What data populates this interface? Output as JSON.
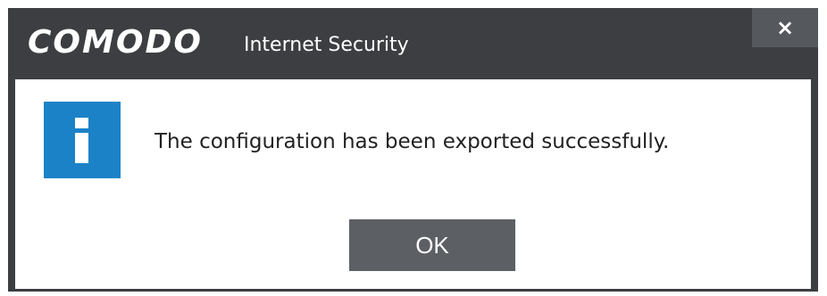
{
  "window": {
    "brand": "COMODO",
    "product": "Internet Security",
    "close_label": "×"
  },
  "dialog": {
    "icon": "info-icon",
    "message": "The configuration has been exported successfully.",
    "ok_label": "OK"
  },
  "colors": {
    "titlebar": "#3c3e41",
    "close_button": "#55585c",
    "info_icon": "#1c82c8",
    "ok_button": "#5c5f64"
  }
}
